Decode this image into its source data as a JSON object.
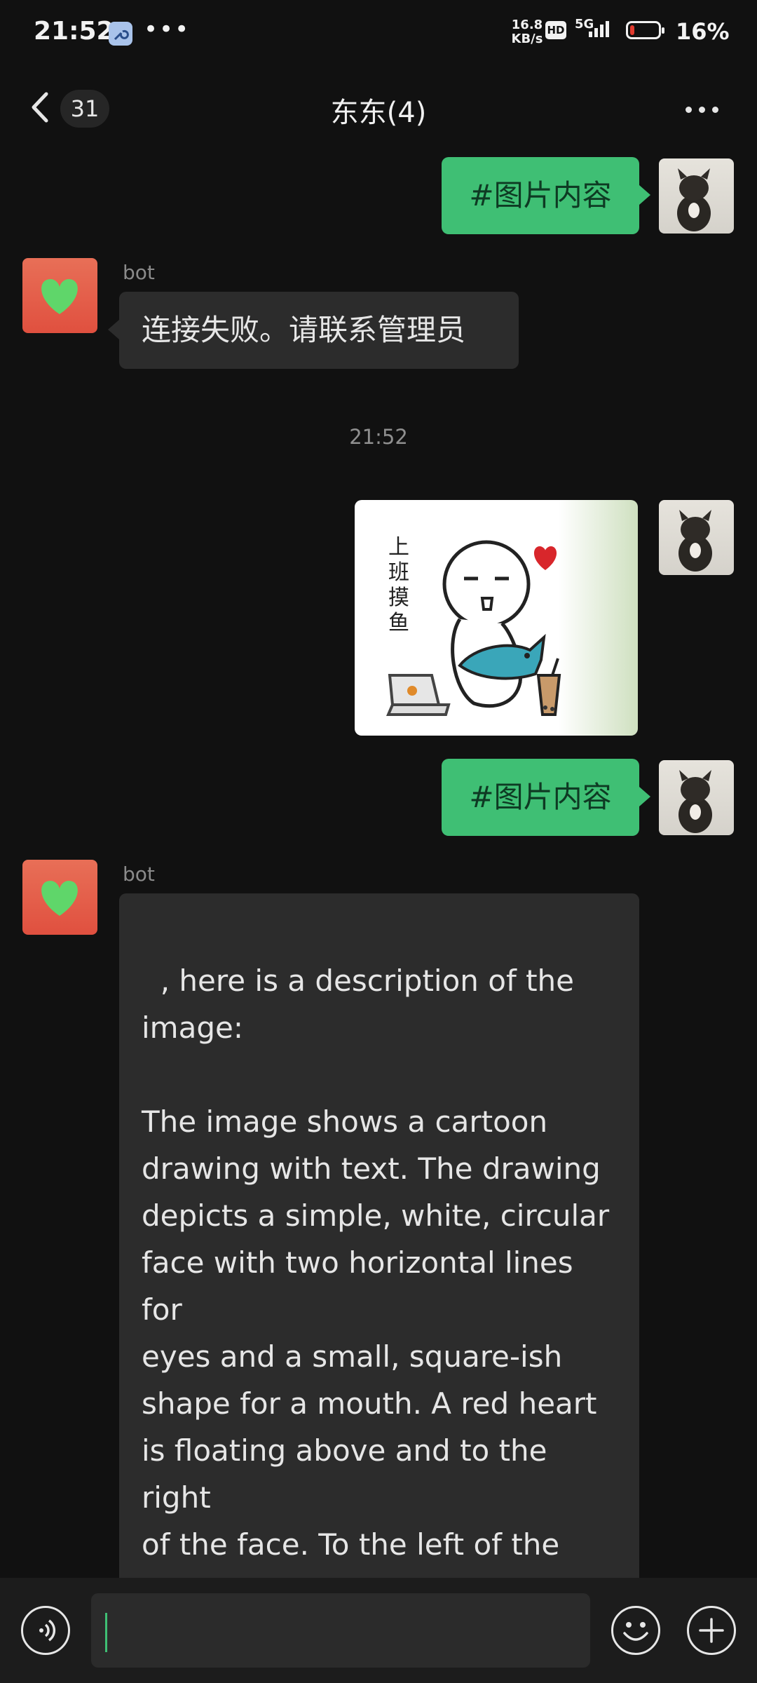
{
  "status_bar": {
    "time": "21:52",
    "speed_value": "16.8",
    "speed_unit": "KB/s",
    "hd_label": "HD",
    "network": "5G",
    "battery_percent": "16%",
    "battery_level": 0.16,
    "battery_color": "#e23b2f"
  },
  "header": {
    "unread_count": "31",
    "title": "东东(4)"
  },
  "messages": [
    {
      "side": "right",
      "type": "text",
      "text": "#图片内容"
    },
    {
      "side": "left",
      "sender": "bot",
      "type": "text",
      "text": "连接失败。请联系管理员"
    },
    {
      "type": "time",
      "text": "21:52"
    },
    {
      "side": "right",
      "type": "image",
      "image_text": "上班摸鱼",
      "heart_color": "#d8262b",
      "fish_color": "#3aa6b9"
    },
    {
      "side": "right",
      "type": "text",
      "text": "#图片内容"
    },
    {
      "side": "left",
      "sender": "bot",
      "type": "text",
      "text": ", here is a description of the\nimage:\n\nThe image shows a cartoon\ndrawing with text. The drawing\ndepicts a simple, white, circular\nface with two horizontal lines for\neyes and a small, square-ish\nshape for a mouth. A red heart\nis floating above and to the right\nof the face. To the left of the\nface, there are three vertical\nChinese characters that appear\nto say “ 上班摸 ”. The"
    }
  ],
  "input": {
    "value": ""
  },
  "colors": {
    "accent_green": "#3fbf74",
    "background": "#111111",
    "bubble_gray": "#2c2c2c"
  },
  "icons": [
    "wrench-icon",
    "back-chevron-icon",
    "more-icon",
    "voice-icon",
    "emoji-icon",
    "plus-icon",
    "heart-avatar-icon"
  ]
}
